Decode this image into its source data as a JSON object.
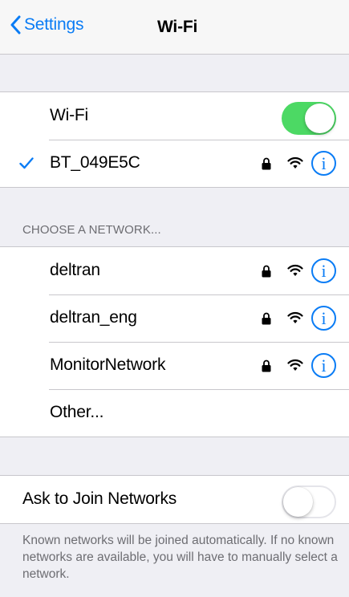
{
  "nav": {
    "back_label": "Settings",
    "title": "Wi-Fi"
  },
  "wifi_toggle": {
    "label": "Wi-Fi",
    "on": true
  },
  "connected": {
    "name": "BT_049E5C",
    "secured": true
  },
  "choose_header": "CHOOSE A NETWORK...",
  "networks": [
    {
      "name": "deltran",
      "secured": true
    },
    {
      "name": "deltran_eng",
      "secured": true
    },
    {
      "name": "MonitorNetwork",
      "secured": true
    }
  ],
  "other_label": "Other...",
  "ask_join": {
    "label": "Ask to Join Networks",
    "on": false
  },
  "footer_text": "Known networks will be joined automatically. If no known networks are available, you will have to manually select a network.",
  "info_glyph": "i",
  "colors": {
    "accent": "#0a7cf5",
    "toggle_on": "#4cd964",
    "background": "#efeff4",
    "separator": "#c8c7cc",
    "secondary_text": "#6d6d72"
  },
  "icons": [
    "chevron-left-icon",
    "checkmark-icon",
    "lock-icon",
    "wifi-icon",
    "info-icon"
  ]
}
